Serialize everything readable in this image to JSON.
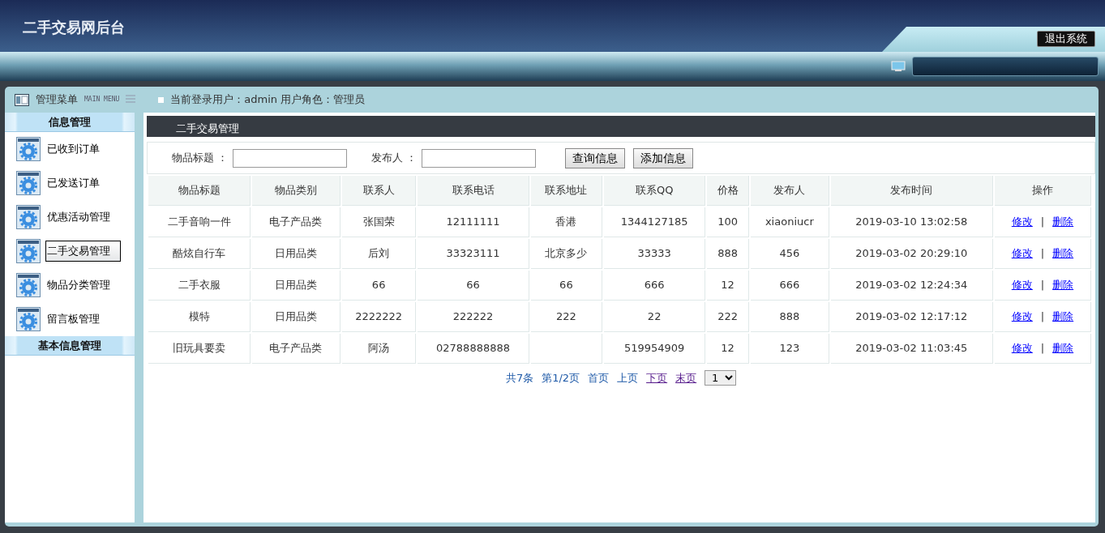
{
  "header": {
    "title": "二手交易网后台",
    "logout": "退出系统"
  },
  "menu_bar": {
    "title": "管理菜单",
    "subtitle": "MAIN MENU",
    "user_info": "当前登录用户：admin  用户角色：管理员"
  },
  "sidebar": {
    "sections": [
      {
        "title": "信息管理",
        "items": [
          {
            "label": "已收到订单",
            "selected": false
          },
          {
            "label": "已发送订单",
            "selected": false
          },
          {
            "label": "优惠活动管理",
            "selected": false
          },
          {
            "label": "二手交易管理",
            "selected": true
          },
          {
            "label": "物品分类管理",
            "selected": false
          },
          {
            "label": "留言板管理",
            "selected": false
          }
        ]
      },
      {
        "title": "基本信息管理"
      }
    ]
  },
  "panel": {
    "title": "二手交易管理"
  },
  "search": {
    "fields": [
      {
        "label": "物品标题 ："
      },
      {
        "label": "发布人 ："
      }
    ],
    "buttons": [
      "查询信息",
      "添加信息"
    ]
  },
  "table": {
    "columns": [
      "物品标题",
      "物品类别",
      "联系人",
      "联系电话",
      "联系地址",
      "联系QQ",
      "价格",
      "发布人",
      "发布时间",
      "操作"
    ],
    "rows": [
      {
        "cells": [
          "二手音响一件",
          "电子产品类",
          "张国荣",
          "12111111",
          "香港",
          "1344127185",
          "100",
          "xiaoniucr",
          "2019-03-10 13:02:58"
        ],
        "actions": [
          "修改",
          "|",
          "删除"
        ]
      },
      {
        "cells": [
          "酷炫自行车",
          "日用品类",
          "后刘",
          "33323111",
          "北京多少",
          "33333",
          "888",
          "456",
          "2019-03-02 20:29:10"
        ],
        "actions": [
          "修改",
          "|",
          "删除"
        ]
      },
      {
        "cells": [
          "二手衣服",
          "日用品类",
          "66",
          "66",
          "66",
          "666",
          "12",
          "666",
          "2019-03-02 12:24:34"
        ],
        "actions": [
          "修改",
          "|",
          "删除"
        ]
      },
      {
        "cells": [
          "模特",
          "日用品类",
          "2222222",
          "222222",
          "222",
          "22",
          "222",
          "888",
          "2019-03-02 12:17:12"
        ],
        "actions": [
          "修改",
          "|",
          "删除"
        ]
      },
      {
        "cells": [
          "旧玩具要卖",
          "电子产品类",
          "阿汤",
          "02788888888",
          "",
          "519954909",
          "12",
          "123",
          "2019-03-02 11:03:45"
        ],
        "actions": [
          "修改",
          "|",
          "删除"
        ]
      }
    ]
  },
  "pagination": {
    "items": [
      {
        "kind": "text",
        "label": "共7条"
      },
      {
        "kind": "text",
        "label": "第1/2页"
      },
      {
        "kind": "text",
        "label": "首页"
      },
      {
        "kind": "text",
        "label": "上页"
      },
      {
        "kind": "link",
        "label": "下页"
      },
      {
        "kind": "link",
        "label": "末页"
      }
    ],
    "page_select": "1"
  }
}
